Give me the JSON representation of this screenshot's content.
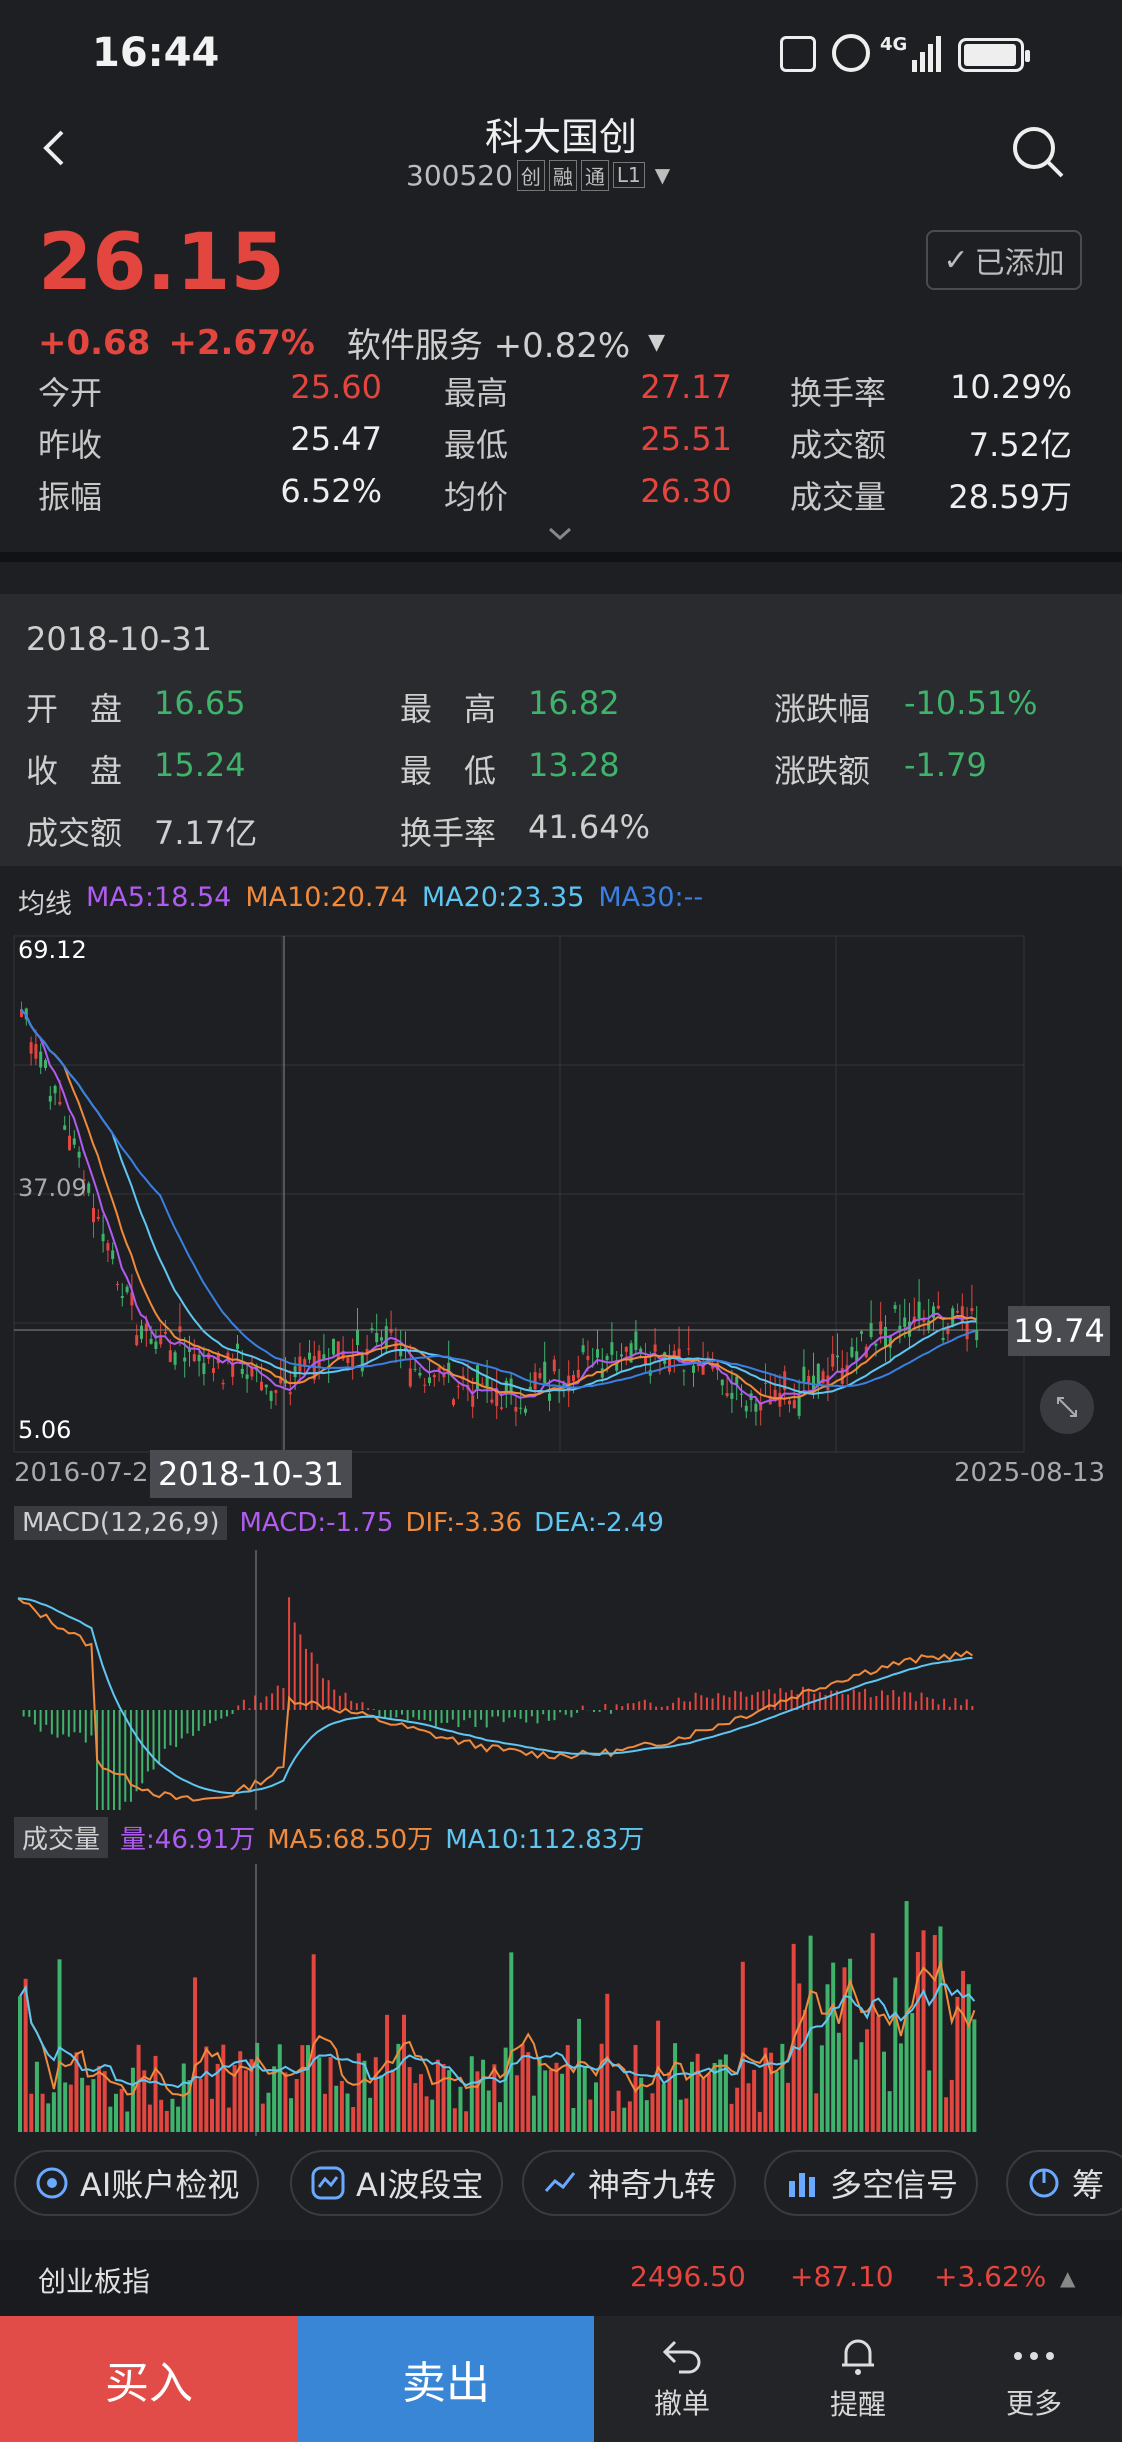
{
  "status": {
    "time": "16:44",
    "network": "4G"
  },
  "header": {
    "title": "科大国创",
    "code": "300520",
    "tags": [
      "创",
      "融",
      "通",
      "L1"
    ]
  },
  "quote": {
    "price": "26.15",
    "change": "+0.68",
    "change_pct": "+2.67%",
    "sector": "软件服务 +0.82%",
    "added_label": "已添加",
    "stats": [
      {
        "label": "今开",
        "value": "25.60",
        "color": "red"
      },
      {
        "label": "最高",
        "value": "27.17",
        "color": "red"
      },
      {
        "label": "换手率",
        "value": "10.29%",
        "color": "white"
      },
      {
        "label": "昨收",
        "value": "25.47",
        "color": "white"
      },
      {
        "label": "最低",
        "value": "25.51",
        "color": "red"
      },
      {
        "label": "成交额",
        "value": "7.52亿",
        "color": "white"
      },
      {
        "label": "振幅",
        "value": "6.52%",
        "color": "white"
      },
      {
        "label": "均价",
        "value": "26.30",
        "color": "red"
      },
      {
        "label": "成交量",
        "value": "28.59万",
        "color": "white"
      }
    ]
  },
  "history": {
    "date": "2018-10-31",
    "items": [
      {
        "label": "开　盘",
        "value": "16.65"
      },
      {
        "label": "最　高",
        "value": "16.82"
      },
      {
        "label": "涨跌幅",
        "value": "-10.51%"
      },
      {
        "label": "收　盘",
        "value": "15.24"
      },
      {
        "label": "最　低",
        "value": "13.28"
      },
      {
        "label": "涨跌额",
        "value": "-1.79"
      },
      {
        "label": "成交额",
        "value": "7.17亿"
      },
      {
        "label": "换手率",
        "value": "41.64%"
      }
    ]
  },
  "ma_legend": {
    "title": "均线",
    "items": [
      {
        "text": "MA5:18.54",
        "color": "#b15cf0"
      },
      {
        "text": "MA10:20.74",
        "color": "#f08a3c"
      },
      {
        "text": "MA20:23.35",
        "color": "#5fc6f2"
      },
      {
        "text": "MA30:--",
        "color": "#3b7fe0"
      }
    ]
  },
  "kline": {
    "y_max": "69.12",
    "y_mid": "37.09",
    "y_min": "5.06",
    "start_date": "2016-07-2",
    "crosshair_date": "2018-10-31",
    "end_date": "2025-08-13",
    "current_price_tag": "19.74"
  },
  "macd": {
    "name": "MACD(12,26,9)",
    "macd": "MACD:-1.75",
    "dif": "DIF:-3.36",
    "dea": "DEA:-2.49"
  },
  "volume": {
    "name": "成交量",
    "vol": "量:46.91万",
    "ma5": "MA5:68.50万",
    "ma10": "MA10:112.83万"
  },
  "tools": [
    "AI账户检视",
    "AI波段宝",
    "神奇九转",
    "多空信号",
    "筹"
  ],
  "index": {
    "name": "创业板指",
    "value": "2496.50",
    "change": "+87.10",
    "pct": "+3.62%"
  },
  "actions": {
    "buy": "买入",
    "sell": "卖出",
    "cancel": "撤单",
    "alert": "提醒",
    "more": "更多"
  }
}
